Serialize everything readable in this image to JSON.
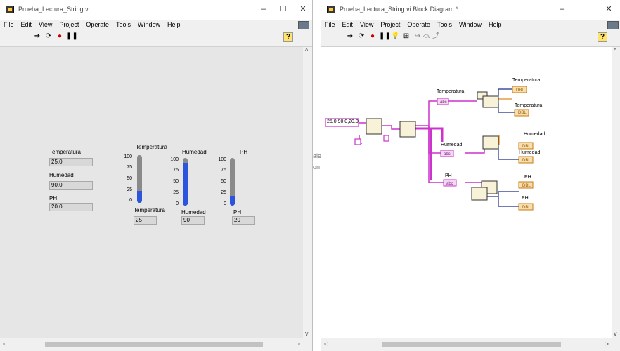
{
  "left_window": {
    "title": "Prueba_Lectura_String.vi",
    "menu": [
      "File",
      "Edit",
      "View",
      "Project",
      "Operate",
      "Tools",
      "Window",
      "Help"
    ],
    "help_label": "?",
    "front_panel": {
      "indicators": [
        {
          "label": "Temperatura",
          "value": "25.0"
        },
        {
          "label": "Humedad",
          "value": "90.0"
        },
        {
          "label": "PH",
          "value": "20.0"
        }
      ],
      "thermometer": {
        "title": "Temperatura",
        "ticks": [
          "100",
          "75",
          "50",
          "25",
          "0"
        ],
        "caption": "Temperatura",
        "value_text": "25",
        "level": 0.25
      },
      "humedad_gauge": {
        "title": "Humedad",
        "ticks": [
          "100",
          "75",
          "50",
          "25",
          "0"
        ],
        "caption": "Humedad",
        "value_text": "90",
        "level": 0.9
      },
      "ph_gauge": {
        "title": "PH",
        "ticks": [
          "100",
          "75",
          "50",
          "25",
          "0"
        ],
        "caption": "PH",
        "value_text": "20",
        "level": 0.2
      }
    }
  },
  "gap_fragments": [
    "ale",
    "on"
  ],
  "right_window": {
    "title": "Prueba_Lectura_String.vi Block Diagram *",
    "menu": [
      "File",
      "Edit",
      "View",
      "Project",
      "Operate",
      "Tools",
      "Window",
      "Help"
    ],
    "help_label": "?",
    "diagram": {
      "string_constant": "25.0,90.0,20.0",
      "dbl_text": "DBL",
      "abc_text": "abc",
      "local_labels": [
        "Temperatura",
        "Humedad",
        "PH"
      ],
      "outputs": [
        {
          "label": "Temperatura"
        },
        {
          "label": "Temperatura"
        },
        {
          "label": "Humedad"
        },
        {
          "label": "Humedad"
        },
        {
          "label": "PH"
        },
        {
          "label": "PH"
        }
      ]
    }
  },
  "colors": {
    "wire_string": "#cc33cc",
    "wire_dbl": "#e08a1e",
    "wire_cluster": "#1a2d8a",
    "fill_blue": "#2a55dc"
  }
}
